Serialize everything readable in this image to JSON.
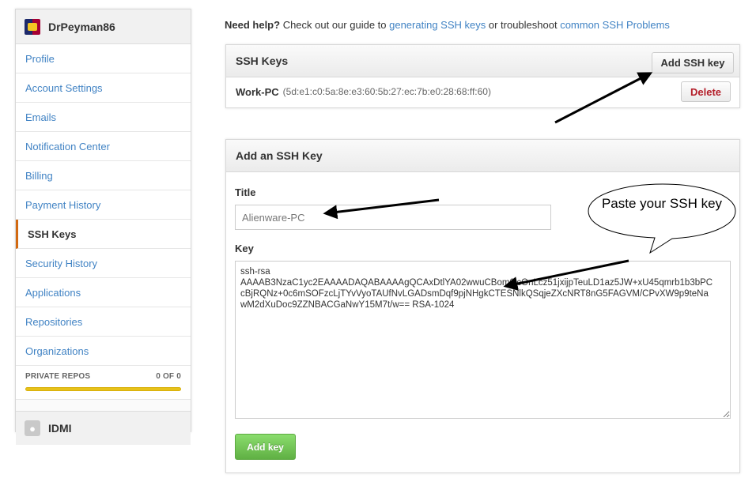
{
  "sidebar": {
    "username": "DrPeyman86",
    "items": [
      {
        "label": "Profile"
      },
      {
        "label": "Account Settings"
      },
      {
        "label": "Emails"
      },
      {
        "label": "Notification Center"
      },
      {
        "label": "Billing"
      },
      {
        "label": "Payment History"
      },
      {
        "label": "SSH Keys",
        "selected": true
      },
      {
        "label": "Security History"
      },
      {
        "label": "Applications"
      },
      {
        "label": "Repositories"
      },
      {
        "label": "Organizations"
      }
    ],
    "private_repos_label": "PRIVATE REPOS",
    "private_repos_count": "0 OF 0",
    "private_repos_usage": 1.0,
    "org_name": "IDMI"
  },
  "help": {
    "prefix": "Need help?",
    "text1": " Check out our guide to ",
    "link1": "generating SSH keys",
    "text2": " or troubleshoot ",
    "link2": "common SSH Problems"
  },
  "ssh_keys": {
    "header": "SSH Keys",
    "add_button": "Add SSH key",
    "keys": [
      {
        "name": "Work-PC",
        "fingerprint": "(5d:e1:c0:5a:8e:e3:60:5b:27:ec:7b:e0:28:68:ff:60)",
        "delete_label": "Delete"
      }
    ]
  },
  "add_form": {
    "header": "Add an SSH Key",
    "title_label": "Title",
    "title_value": "Alienware-PC",
    "key_label": "Key",
    "key_value": "ssh-rsa\nAAAAB3NzaC1yc2EAAAADAQABAAAAgQCAxDtlYA02wwuCBom0lcOnLcz51jxijpTeuLD1az5JW+xU45qmrb1b3bPC\ncBjRQNz+0c6mSOFzcLjTYvVyoTAUfNvLGADsmDqf9pjNHgkCTESNlkQSqjeZXcNRT8nG5FAGVM/CPvXW9p9teNa\nwM2dXuDoc9ZZNBACGaNwY15M7t/w== RSA-1024",
    "submit_label": "Add key"
  },
  "annotation": {
    "bubble_text": "Paste your SSH key"
  },
  "colors": {
    "link": "#4183c4",
    "selected_indicator": "#d26911",
    "progress": "#e7c21a",
    "delete_text": "#b31d28",
    "submit_green": "#60b044"
  }
}
